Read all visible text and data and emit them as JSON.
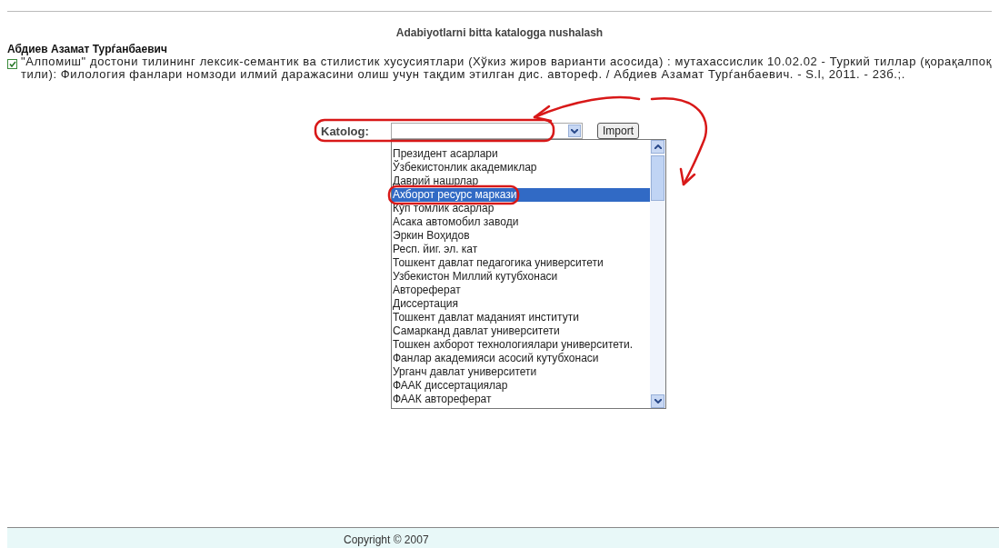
{
  "page": {
    "title": "Adabiyotlarni bitta katalogga nushalash"
  },
  "record": {
    "author": "Абдиев Азамат Турѓанбаевич",
    "checked": true,
    "description": "\"Алпомиш\" достони тилининг лексик-семантик ва стилистик хусусиятлари (Хўкиз жиров варианти асосида) : мутахассислик 10.02.02 - Туркий тиллар (қорақалпоқ тили): Филология фанлари номзоди илмий даражасини олиш учун тақдим этилган дис. автореф. / Абдиев Азамат Турѓанбаевич. - S.l, 2011. - 23б.;."
  },
  "catalog": {
    "label": "Katolog:",
    "button": "Import",
    "options": [
      {
        "label": "Президент асарлари",
        "selected": false
      },
      {
        "label": "Ўзбекистонлик академиклар",
        "selected": false
      },
      {
        "label": "Даврий нашрлар",
        "selected": false
      },
      {
        "label": "Ахборот ресурс маркази",
        "selected": true
      },
      {
        "label": "Кўп томлик асарлар",
        "selected": false
      },
      {
        "label": "Асака автомобил заводи",
        "selected": false
      },
      {
        "label": "Эркин Воҳидов",
        "selected": false
      },
      {
        "label": "Респ. йиг. эл. кат",
        "selected": false
      },
      {
        "label": "Тошкент давлат педагогика университети",
        "selected": false
      },
      {
        "label": "Узбекистон Миллий кутубхонаси",
        "selected": false
      },
      {
        "label": "Автореферат",
        "selected": false
      },
      {
        "label": "Диссертация",
        "selected": false
      },
      {
        "label": "Тошкент давлат маданият институти",
        "selected": false
      },
      {
        "label": "Самарканд давлат университети",
        "selected": false
      },
      {
        "label": "Тошкен ахборот технологиялари университети.",
        "selected": false
      },
      {
        "label": "Фанлар академияси асосий кутубхонаси",
        "selected": false
      },
      {
        "label": "Урганч давлат университети",
        "selected": false
      },
      {
        "label": "ФААК диссертациялар",
        "selected": false
      },
      {
        "label": "ФААК автореферат",
        "selected": false
      }
    ]
  },
  "footer": {
    "text": "Copyright © 2007"
  }
}
